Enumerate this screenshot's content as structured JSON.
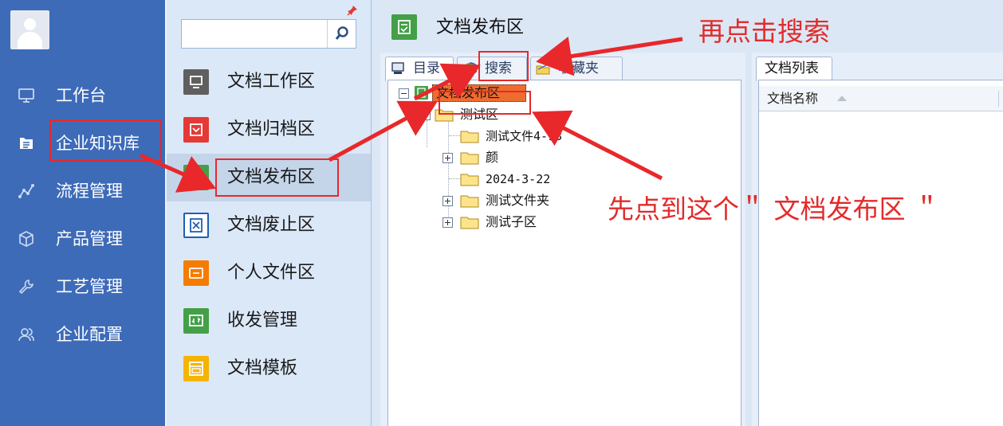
{
  "sidebar": {
    "items": [
      {
        "label": "工作台",
        "icon": "monitor-icon"
      },
      {
        "label": "企业知识库",
        "icon": "book-icon"
      },
      {
        "label": "流程管理",
        "icon": "workflow-icon"
      },
      {
        "label": "产品管理",
        "icon": "cube-icon"
      },
      {
        "label": "工艺管理",
        "icon": "wrench-icon"
      },
      {
        "label": "企业配置",
        "icon": "users-icon"
      }
    ]
  },
  "subnav": {
    "search": {
      "value": "",
      "placeholder": ""
    },
    "items": [
      {
        "label": "文档工作区",
        "icon": "monitor-icon",
        "color": "#5f5f5f"
      },
      {
        "label": "文档归档区",
        "icon": "archive-icon",
        "color": "#e53935"
      },
      {
        "label": "文档发布区",
        "icon": "publish-icon",
        "color": "#43a047"
      },
      {
        "label": "文档废止区",
        "icon": "void-icon",
        "color": "#1e5fb4"
      },
      {
        "label": "个人文件区",
        "icon": "personal-file-icon",
        "color": "#f57c00"
      },
      {
        "label": "收发管理",
        "icon": "send-receive-icon",
        "color": "#43a047"
      },
      {
        "label": "文档模板",
        "icon": "template-icon",
        "color": "#f5b400"
      }
    ]
  },
  "main": {
    "title": "文档发布区",
    "tabs": [
      {
        "label": "目录",
        "icon": "directory-icon"
      },
      {
        "label": "搜索",
        "icon": "search-globe-icon"
      },
      {
        "label": "收藏夹",
        "icon": "favorites-icon"
      }
    ],
    "tree": {
      "root": "文档发布区",
      "child": "测试区",
      "items": [
        "测试文件4-13",
        "颜",
        "2024-3-22",
        "测试文件夹",
        "测试子区"
      ]
    },
    "list": {
      "tab": "文档列表",
      "column": "文档名称"
    }
  },
  "annotations": {
    "top": "再点击搜索",
    "middle": "先点到这个＂ 文档发布区 ＂"
  },
  "colors": {
    "nav_bg": "#3d6bb8",
    "subnav_bg": "#dbe8f8",
    "highlight": "#e8282b",
    "annotation": "#e32b2b"
  }
}
